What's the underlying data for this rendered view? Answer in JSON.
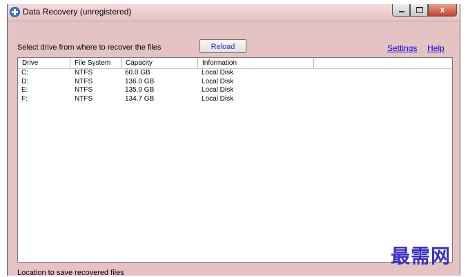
{
  "window": {
    "title": "Data Recovery (unregistered)",
    "close_glyph": "x",
    "icon": "app-recovery-icon"
  },
  "toolbar": {
    "select_label": "Select drive from where to recover the files",
    "reload_label": "Reload",
    "settings_label": "Settings",
    "help_label": "Help"
  },
  "drives": {
    "columns": [
      "Drive",
      "File System",
      "Capacity",
      "Information"
    ],
    "rows": [
      [
        "C:",
        "NTFS",
        "60.0 GB",
        "Local Disk"
      ],
      [
        "D:",
        "NTFS",
        "136.0 GB",
        "Local Disk"
      ],
      [
        "E:",
        "NTFS",
        "135.0 GB",
        "Local Disk"
      ],
      [
        "F:",
        "NTFS",
        "134.7 GB",
        "Local Disk"
      ]
    ]
  },
  "footer": {
    "save_label": "Location to save recovered files"
  },
  "watermark": {
    "text": "最需网"
  },
  "colors": {
    "window_background": "#e6c3c3",
    "link": "#0000ee",
    "reload_text": "#2b2bd6",
    "watermark": "#3a2fc4"
  }
}
